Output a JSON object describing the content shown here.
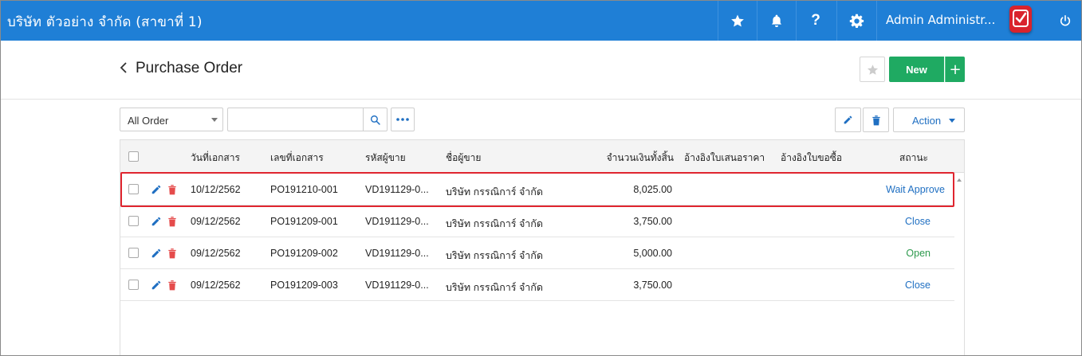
{
  "topbar": {
    "company": "บริษัท ตัวอย่าง จำกัด (สาขาที่ 1)",
    "favorites_icon": "star-icon",
    "notifications_icon": "bell-icon",
    "help_icon": "question-icon",
    "settings_icon": "gear-icon",
    "user_name": "Admin Administr...",
    "logout_icon": "power-icon",
    "color": "#1f7fd6"
  },
  "page": {
    "title": "Purchase Order",
    "new_label": "New",
    "plus_label": "+"
  },
  "toolbar": {
    "filter_value": "All Order",
    "search_placeholder": "",
    "action_label": "Action"
  },
  "table": {
    "headers": {
      "doc_date": "วันที่เอกสาร",
      "doc_no": "เลขที่เอกสาร",
      "vendor_code": "รหัสผู้ขาย",
      "vendor_name": "ชื่อผู้ขาย",
      "total": "จำนวนเงินทั้งสิ้น",
      "ref_quote": "อ้างอิงใบเสนอราคา",
      "ref_request": "อ้างอิงใบขอซื้อ",
      "status": "สถานะ"
    },
    "rows": [
      {
        "date": "10/12/2562",
        "doc_no": "PO191210-001",
        "vendor_code": "VD191129-0...",
        "vendor_name": "บริษัท กรรณิการ์ จำกัด",
        "total": "8,025.00",
        "status": "Wait Approve"
      },
      {
        "date": "09/12/2562",
        "doc_no": "PO191209-001",
        "vendor_code": "VD191129-0...",
        "vendor_name": "บริษัท กรรณิการ์ จำกัด",
        "total": "3,750.00",
        "status": "Close"
      },
      {
        "date": "09/12/2562",
        "doc_no": "PO191209-002",
        "vendor_code": "VD191129-0...",
        "vendor_name": "บริษัท กรรณิการ์ จำกัด",
        "total": "5,000.00",
        "status": "Open"
      },
      {
        "date": "09/12/2562",
        "doc_no": "PO191209-003",
        "vendor_code": "VD191129-0...",
        "vendor_name": "บริษัท กรรณิการ์ จำกัด",
        "total": "3,750.00",
        "status": "Close"
      }
    ]
  },
  "colors": {
    "primary": "#1f7fd6",
    "new_button": "#1faa62",
    "status_blue": "#1f6fc2",
    "status_open": "#2e9a4e",
    "delete_red": "#e54b4b",
    "highlight": "#e0252f"
  }
}
